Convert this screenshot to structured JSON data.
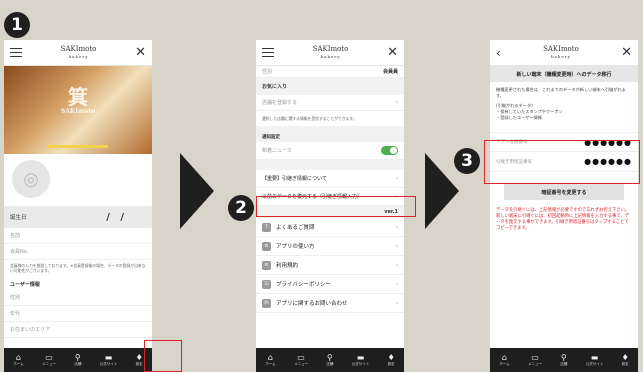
{
  "steps": [
    "1",
    "2",
    "3"
  ],
  "logo": {
    "name": "SAKImoto",
    "sub": "bakery"
  },
  "tabs": [
    {
      "icon": "⌂",
      "label": "ホーム"
    },
    {
      "icon": "▭",
      "label": "メニュー"
    },
    {
      "icon": "⚲",
      "label": "店舗"
    },
    {
      "icon": "▬",
      "label": "公式サイト"
    },
    {
      "icon": "♦",
      "label": "設定"
    }
  ],
  "screen1": {
    "birthday_label": "誕生日",
    "birthday_value": "/   /",
    "name_label": "名前",
    "member_label": "会員No.",
    "note": "会員様の入力を推奨しております。※会員登録後の場合、データの登録が出来ない可能性がございます。",
    "user_info": "ユーザー情報",
    "gender": "性別",
    "age": "年代",
    "area": "お住まいのエリア"
  },
  "screen2": {
    "top_left": "性別",
    "top_right": "会員員",
    "favorites": "お気に入り",
    "register_store": "店舗を登録する",
    "store_note": "選択した店舗に関する情報を受信することができます。",
    "notify_settings": "通知設定",
    "news": "新着ニュース",
    "transfer": "【重要】引継ぎ情報について",
    "restore": "以前のデータを復元する（引継ぎ情報入力）",
    "version": "ver.1",
    "menu": [
      {
        "icon": "?",
        "label": "よくあるご質問"
      },
      {
        "icon": "≡",
        "label": "アプリの使い方"
      },
      {
        "icon": "≡",
        "label": "利用規約"
      },
      {
        "icon": "⊡",
        "label": "プライバシーポリシー"
      },
      {
        "icon": "✉",
        "label": "アプリに関するお問い合わせ"
      }
    ]
  },
  "screen3": {
    "header": "新しい端末（機種変更時）へのデータ移行",
    "intro": "機種変更された場合は、これまでのデータが新しい端末へ引継がれます。",
    "data_title": "(引継がれるデータ)",
    "data_item1": "・保有していたスタンプやクーポン",
    "data_item2": "・登録したユーザー情報",
    "app_member_label": "アプリ会員番号",
    "app_member_value": "●●●●●●",
    "pin_label": "引継ぎ用暗証番号",
    "pin_value": "●●●●●●",
    "change_pin": "暗証番号を変更する",
    "warning": "データを引継ぐには、上記情報が必要ですので忘れずお控え下さい。新しい端末に引継ぐには、初回起動時に上記情報を入力する事で、データを復元する事ができます。引継ぎ用暗証番号はタップすることでコピーできます。"
  },
  "colors": {
    "accent_red": "#d7262b",
    "toggle_green": "#4caf50",
    "dark": "#1e1e1e"
  }
}
